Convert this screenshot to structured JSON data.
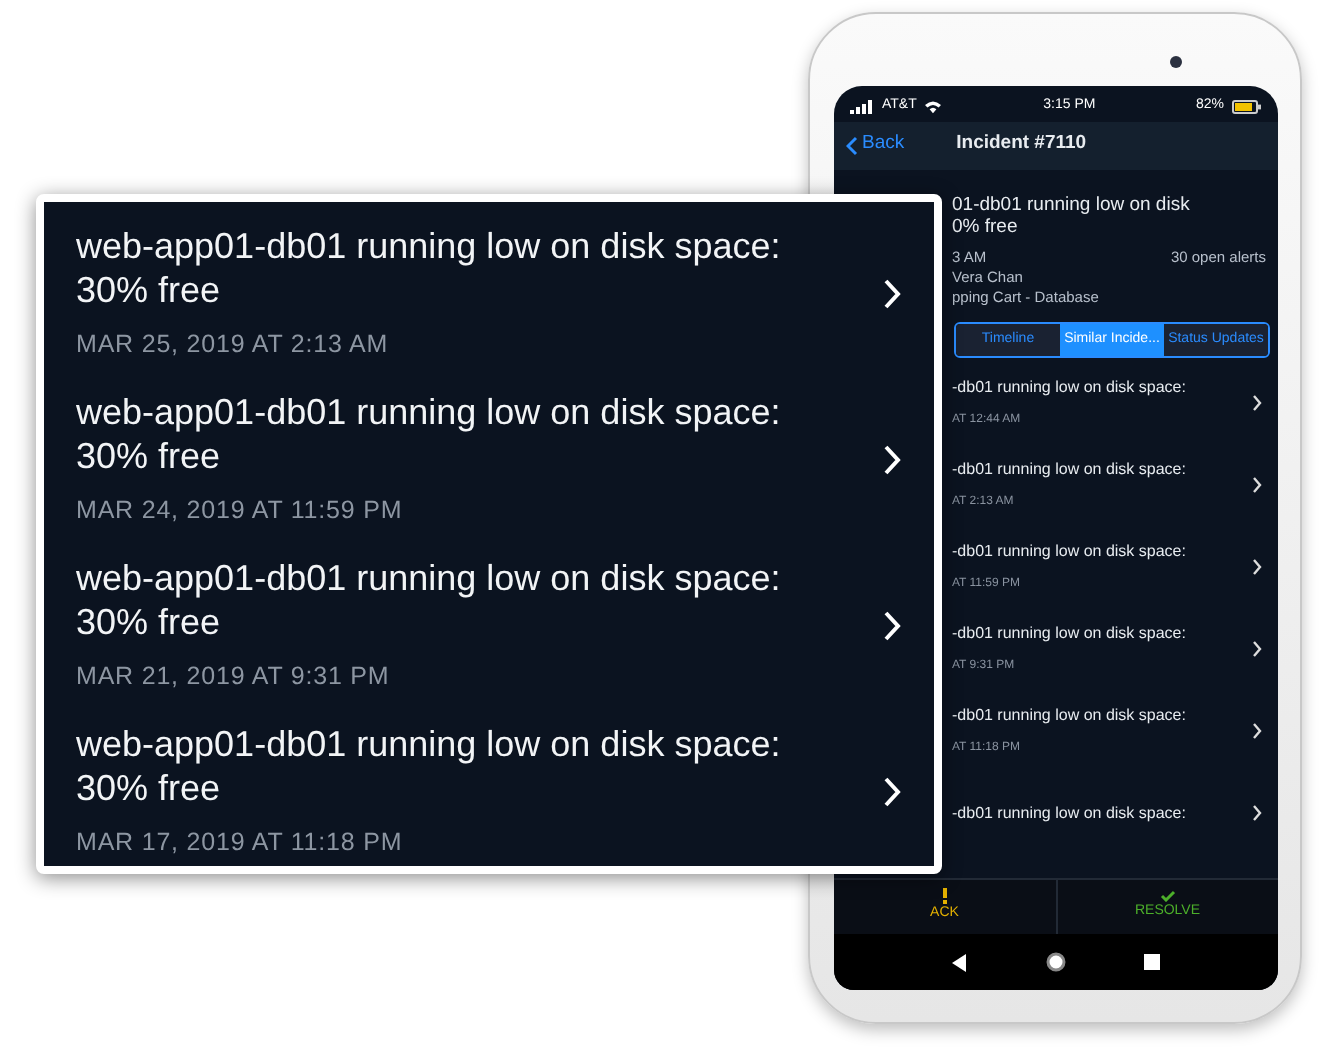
{
  "phone": {
    "status_bar": {
      "carrier": "AT&T",
      "time": "3:15 PM",
      "battery": "82%"
    },
    "nav": {
      "back": "Back",
      "title": "Incident #7110"
    },
    "incident": {
      "title_lines": [
        "01-db01 running low on disk",
        "0% free"
      ],
      "time": "3 AM",
      "open_alerts": "30 open alerts",
      "assignee": "Vera Chan",
      "service": "pping Cart - Database"
    },
    "tabs": [
      {
        "label": "Timeline",
        "selected": false
      },
      {
        "label": "Similar Incide...",
        "selected": true
      },
      {
        "label": "Status Updates",
        "selected": false
      }
    ],
    "similar_incidents": [
      {
        "title": "-db01 running low on disk space:",
        "time": "AT 12:44 AM"
      },
      {
        "title": "-db01 running low on disk space:",
        "time": "AT 2:13 AM"
      },
      {
        "title": "-db01 running low on disk space:",
        "time": "AT 11:59 PM"
      },
      {
        "title": "-db01 running low on disk space:",
        "time": "AT 9:31 PM"
      },
      {
        "title": "-db01 running low on disk space:",
        "time": "AT 11:18 PM"
      },
      {
        "title": "-db01 running low on disk space:"
      }
    ],
    "actions": [
      {
        "label": "ACK",
        "kind": "ack"
      },
      {
        "label": "RESOLVE",
        "kind": "resolve"
      }
    ]
  },
  "callout": {
    "items": [
      {
        "title": "web-app01-db01 running low on disk space: 30% free",
        "date": "MAR 25, 2019 AT 2:13 AM"
      },
      {
        "title": "web-app01-db01 running low on disk space: 30% free",
        "date": "MAR 24, 2019 AT 11:59 PM"
      },
      {
        "title": "web-app01-db01 running low on disk space: 30% free",
        "date": "MAR 21, 2019 AT 9:31 PM"
      },
      {
        "title": "web-app01-db01 running low on disk space: 30% free",
        "date": "MAR 17, 2019 AT 11:18 PM"
      }
    ]
  }
}
